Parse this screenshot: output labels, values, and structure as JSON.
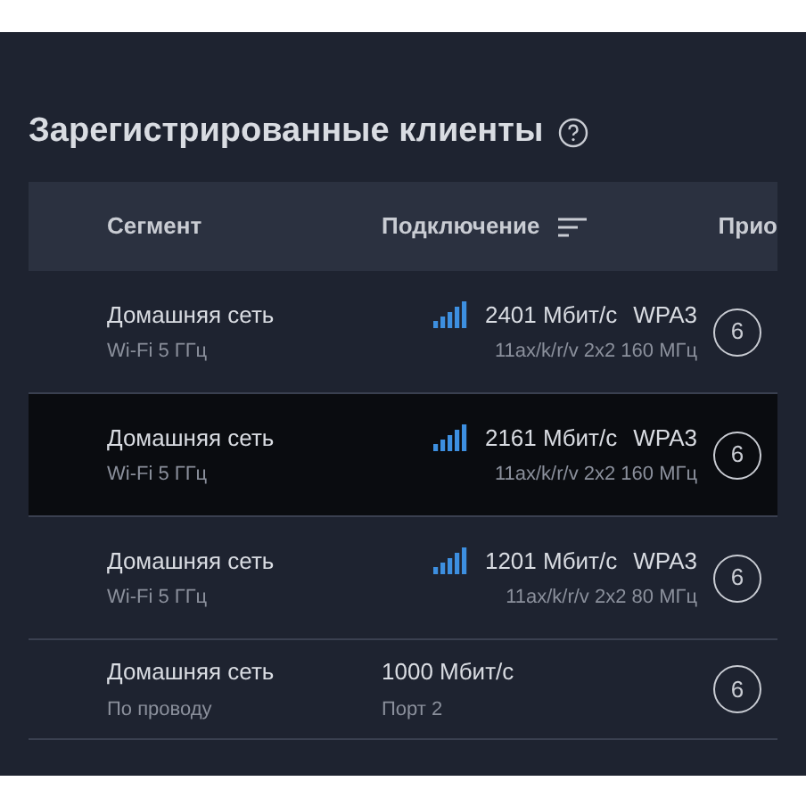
{
  "title": "Зарегистрированные клиенты",
  "columns": [
    "Сегмент",
    "Подключение",
    "Прио"
  ],
  "rows": [
    {
      "kind": "wifi",
      "segment": "Домашняя сеть",
      "band": "Wi-Fi 5 ГГц",
      "speed": "2401 Мбит/с",
      "security": "WPA3",
      "detail": "11ax/k/r/v 2x2 160 МГц",
      "priority": "6",
      "selected": false
    },
    {
      "kind": "wifi",
      "segment": "Домашняя сеть",
      "band": "Wi-Fi 5 ГГц",
      "speed": "2161 Мбит/с",
      "security": "WPA3",
      "detail": "11ax/k/r/v 2x2 160 МГц",
      "priority": "6",
      "selected": true
    },
    {
      "kind": "wifi",
      "segment": "Домашняя сеть",
      "band": "Wi-Fi 5 ГГц",
      "speed": "1201 Мбит/с",
      "security": "WPA3",
      "detail": "11ax/k/r/v 2x2 80 МГц",
      "priority": "6",
      "selected": false
    },
    {
      "kind": "wired",
      "segment": "Домашняя сеть",
      "band": "По проводу",
      "speed": "1000 Мбит/с",
      "detail": "Порт 2",
      "priority": "6",
      "selected": false
    }
  ]
}
